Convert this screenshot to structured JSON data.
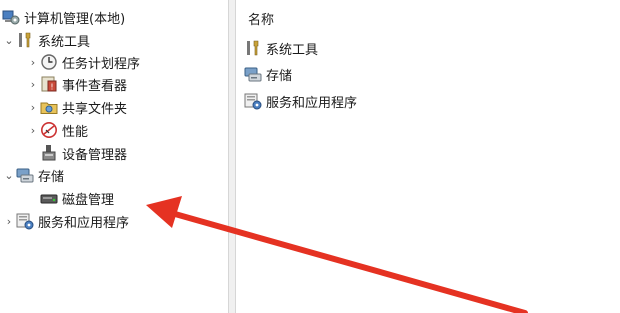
{
  "tree": {
    "root": {
      "label": "计算机管理(本地)",
      "icon": "computer-management-icon"
    },
    "system_tools": {
      "label": "系统工具",
      "icon": "tools-icon",
      "expanded": true,
      "children": [
        {
          "label": "任务计划程序",
          "icon": "clock-icon"
        },
        {
          "label": "事件查看器",
          "icon": "event-viewer-icon"
        },
        {
          "label": "共享文件夹",
          "icon": "shared-folder-icon"
        },
        {
          "label": "性能",
          "icon": "performance-icon"
        },
        {
          "label": "设备管理器",
          "icon": "device-manager-icon"
        }
      ]
    },
    "storage": {
      "label": "存储",
      "icon": "storage-icon",
      "expanded": true,
      "children": [
        {
          "label": "磁盘管理",
          "icon": "disk-icon"
        }
      ]
    },
    "services": {
      "label": "服务和应用程序",
      "icon": "services-icon"
    }
  },
  "details": {
    "column_header": "名称",
    "items": [
      {
        "label": "系统工具",
        "icon": "tools-icon"
      },
      {
        "label": "存储",
        "icon": "storage-icon"
      },
      {
        "label": "服务和应用程序",
        "icon": "services-icon"
      }
    ]
  },
  "annotation": {
    "color": "#e53222",
    "icon": "red-arrow"
  }
}
